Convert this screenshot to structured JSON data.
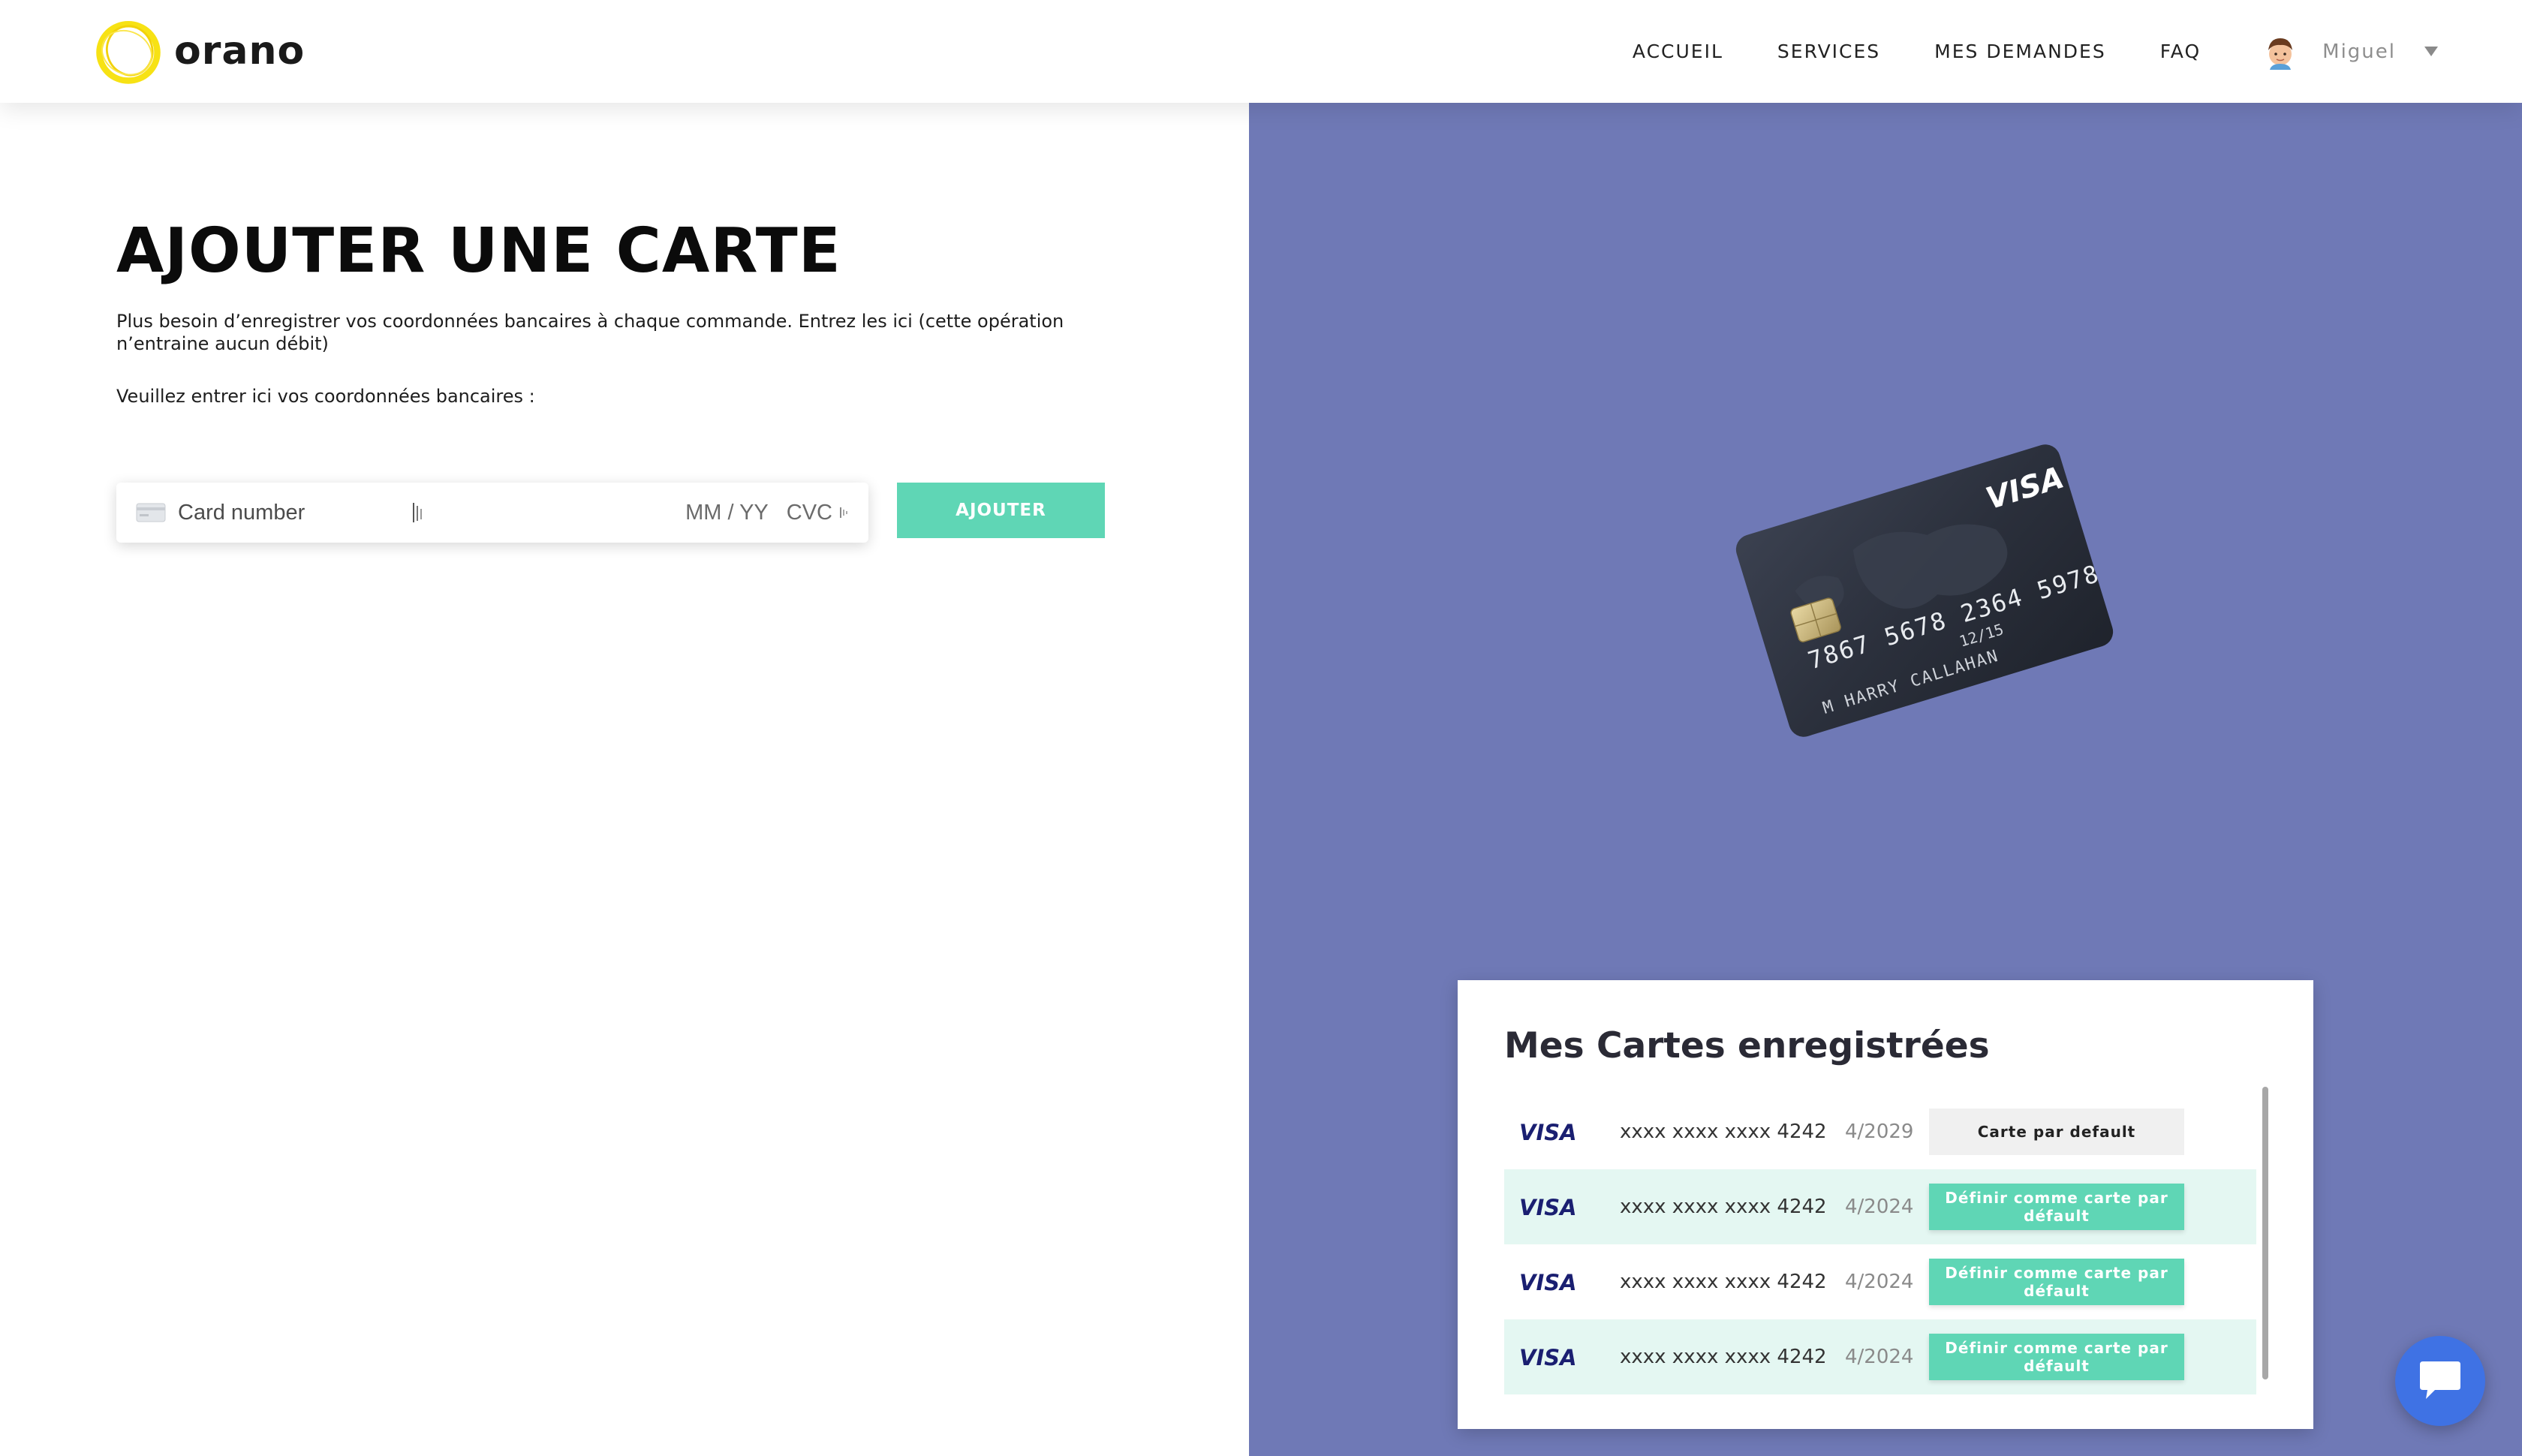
{
  "brand": {
    "name": "orano",
    "ring_color": "#f7e214"
  },
  "nav": {
    "items": [
      {
        "label": "ACCUEIL"
      },
      {
        "label": "SERVICES"
      },
      {
        "label": "MES DEMANDES"
      },
      {
        "label": "FAQ"
      }
    ],
    "user": {
      "name": "Miguel",
      "avatar_icon": "user-avatar-icon"
    }
  },
  "form": {
    "title": "AJOUTER UNE CARTE",
    "description": "Plus besoin d’enregistrer vos coordonnées bancaires à chaque commande. Entrez les ici (cette opération n’entraine aucun débit)",
    "prompt": "Veuillez entrer ici vos coordonnées bancaires :",
    "card_number_placeholder": "Card number",
    "expiry_placeholder": "MM / YY",
    "cvc_placeholder": "CVC",
    "submit_label": "AJOUTER",
    "accent_color": "#5fd6b5"
  },
  "illustration": {
    "brand": "VISA",
    "number": "7867 5678 2364 5978",
    "expiry": "12/15",
    "holder": "M HARRY CALLAHAN"
  },
  "saved_cards": {
    "title": "Mes Cartes enregistrées",
    "cards": [
      {
        "brand": "VISA",
        "number": "xxxx xxxx xxxx 4242",
        "expiry": "4/2029",
        "action": "Carte par default",
        "is_default": true
      },
      {
        "brand": "VISA",
        "number": "xxxx xxxx xxxx 4242",
        "expiry": "4/2024",
        "action": "Définir comme carte par défault",
        "is_default": false
      },
      {
        "brand": "VISA",
        "number": "xxxx xxxx xxxx 4242",
        "expiry": "4/2024",
        "action": "Définir comme carte par défault",
        "is_default": false
      },
      {
        "brand": "VISA",
        "number": "xxxx xxxx xxxx 4242",
        "expiry": "4/2024",
        "action": "Définir comme carte par défault",
        "is_default": false
      }
    ]
  },
  "colors": {
    "panel_bg": "#6f79b6",
    "chat_button": "#3f72e4"
  },
  "chat": {
    "icon": "chat-bubble-icon"
  }
}
